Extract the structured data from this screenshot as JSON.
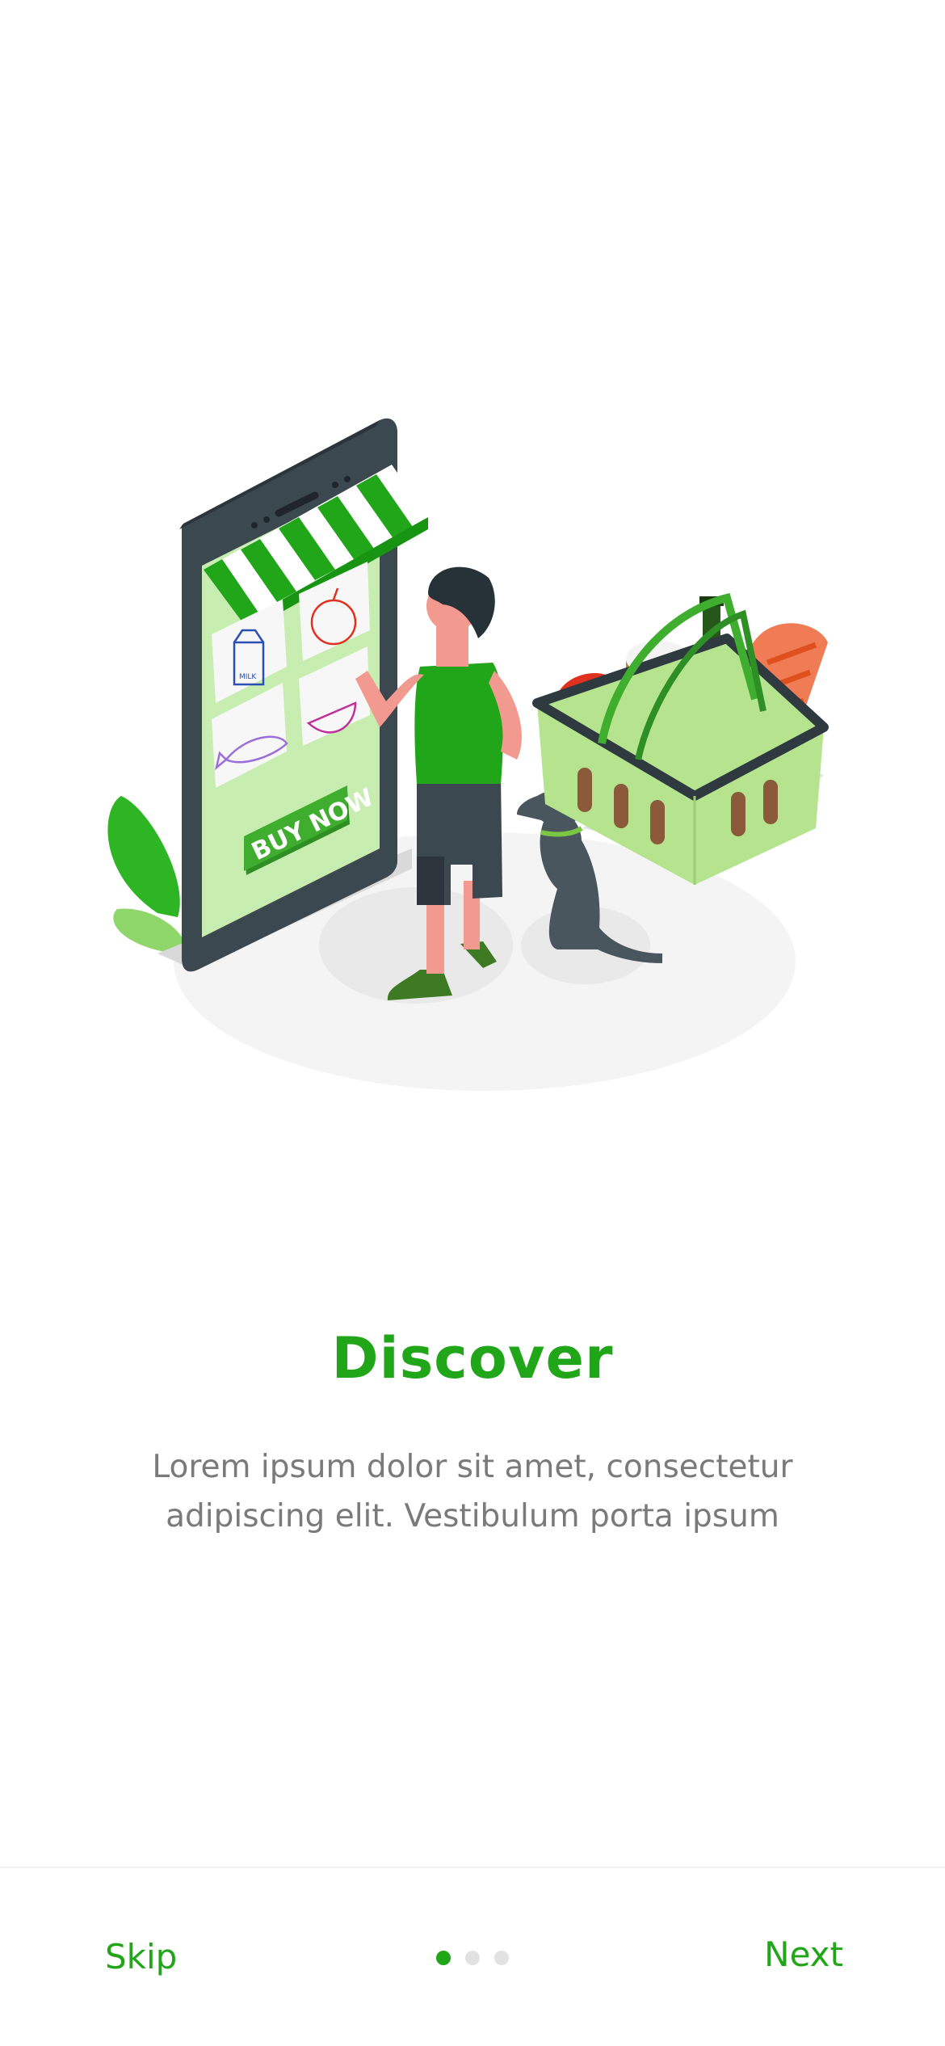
{
  "onboarding": {
    "title": "Discover",
    "description": "Lorem ipsum dolor sit amet, consectetur adipiscing elit. Vestibulum porta ipsum",
    "illustration_badge": "BUY NOW",
    "illustration_milk": "MILK"
  },
  "footer": {
    "skip_label": "Skip",
    "next_label": "Next",
    "pages_total": 3,
    "current_page": 1
  },
  "colors": {
    "accent": "#21A519",
    "text_muted": "#7a7a7a",
    "dot_inactive": "#e2e2e2"
  }
}
